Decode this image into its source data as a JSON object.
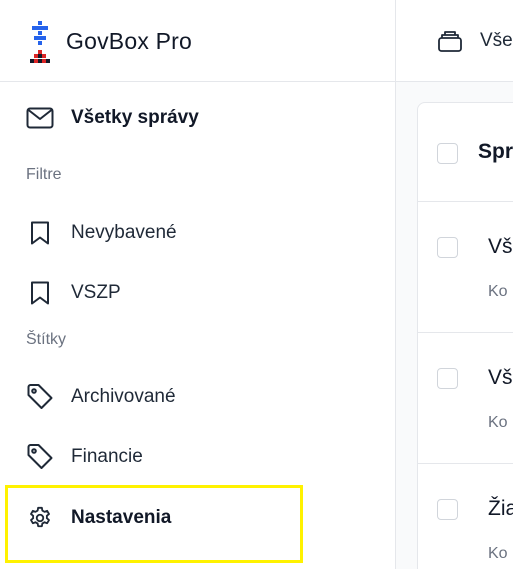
{
  "app": {
    "name": "GovBox Pro"
  },
  "sidebar": {
    "all_messages": "Všetky správy",
    "filters_title": "Filtre",
    "filters": [
      {
        "label": "Nevybavené",
        "icon": "bookmark-icon"
      },
      {
        "label": "VSZP",
        "icon": "bookmark-icon"
      }
    ],
    "tags_title": "Štítky",
    "tags": [
      {
        "label": "Archivované",
        "icon": "tag-icon"
      },
      {
        "label": "Financie",
        "icon": "tag-icon"
      }
    ],
    "settings": "Nastavenia"
  },
  "main": {
    "topbar_label": "Vše",
    "list_header": "Spr",
    "rows": [
      {
        "title": "Vš",
        "sub": "Ko"
      },
      {
        "title": "Vš",
        "sub": "Ko"
      },
      {
        "title": "Žia",
        "sub": "Ko"
      }
    ]
  },
  "colors": {
    "highlight": "#fff200",
    "border": "#e5e7eb",
    "logo_blue": "#2563eb",
    "logo_red": "#dc2626"
  }
}
